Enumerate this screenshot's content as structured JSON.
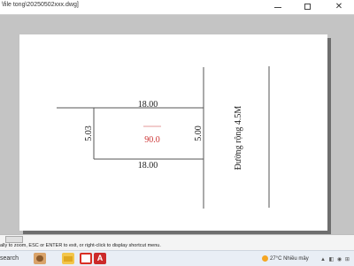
{
  "window": {
    "title": "\\file tong\\20250502xxx.dwg]",
    "close_glyph": "✕"
  },
  "drawing": {
    "top_width": "18.00",
    "bottom_width": "18.00",
    "left_height": "5.03",
    "right_height": "5.00",
    "area": "90.0",
    "road_label": "Đường rộng 4.5M",
    "colors": {
      "area_text": "#cc3333",
      "line": "#555555"
    }
  },
  "command_line": {
    "prompt": "ally to zoom, ESC or ENTER to exit, or right-click to display shortcut menu."
  },
  "taskbar": {
    "search_label": "search",
    "cad_label": "A",
    "weather": "27°C Nhiều mây",
    "tray_icons": "▲ ◧ ◉ ⊞"
  }
}
